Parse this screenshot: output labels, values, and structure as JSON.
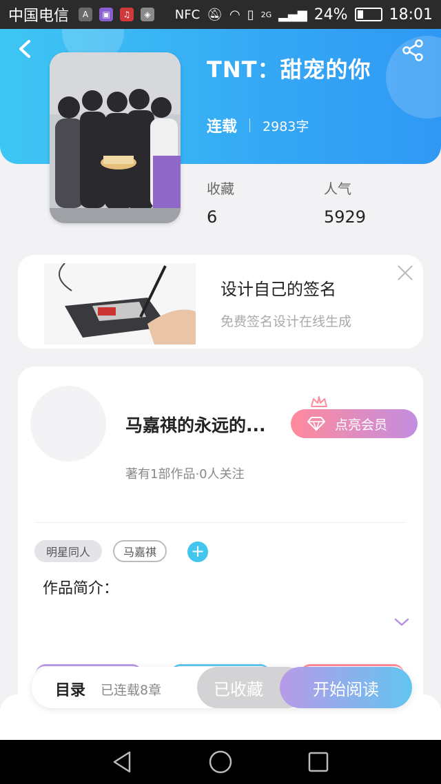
{
  "status_bar": {
    "carrier": "中国电信",
    "app_icons": [
      "A"
    ],
    "network": "2G",
    "battery": "24%",
    "battery_level": 0.24,
    "time": "18:01"
  },
  "book": {
    "title": "TNT：甜宠的你",
    "status": "连载",
    "word_count": "2983字",
    "favorites_label": "收藏",
    "favorites_value": "6",
    "popularity_label": "人气",
    "popularity_value": "5929"
  },
  "ad": {
    "title": "设计自己的签名",
    "subtitle": "免费签名设计在线生成"
  },
  "author": {
    "name": "马嘉祺的永远的...",
    "info": "著有1部作品·0人关注",
    "vip_label": "点亮会员"
  },
  "tags": [
    "明星同人",
    "马嘉祺"
  ],
  "intro_label": "作品简介：",
  "action_bar": {
    "toc": "目录",
    "chapters": "已连载8章",
    "favorited": "已收藏",
    "read": "开始阅读"
  },
  "colors": {
    "header_start": "#3ec6f3",
    "header_end": "#2f98f4",
    "vip_start": "#ff8a9b",
    "vip_end": "#c28ee0",
    "read_start": "#b89ae8",
    "read_end": "#62c5f0",
    "accent": "#43c6ee"
  },
  "icons": [
    "back-arrow-icon",
    "share-icon",
    "close-icon",
    "diamond-icon",
    "crown-icon",
    "plus-icon",
    "chevron-down-icon",
    "nav-back-icon",
    "nav-home-icon",
    "nav-recents-icon"
  ]
}
